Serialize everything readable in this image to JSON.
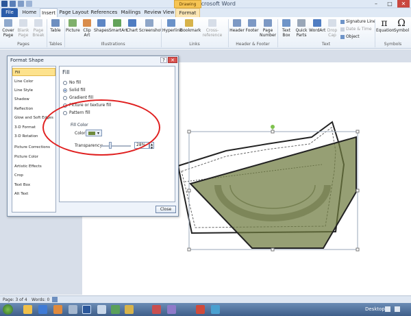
{
  "window": {
    "title": "Doc2 - Microsoft Word",
    "context_tab": "Drawing Tools",
    "controls": {
      "minimize": "–",
      "maximize": "□",
      "close": "✕"
    }
  },
  "quick_access": {
    "save_icon": "save-icon",
    "undo_icon": "undo-icon",
    "redo_icon": "redo-icon"
  },
  "tabs": [
    "File",
    "Home",
    "Insert",
    "Page Layout",
    "References",
    "Mailings",
    "Review",
    "View",
    "Format"
  ],
  "active_tab": "Insert",
  "ribbon": {
    "pages": {
      "cover_page": "Cover Page",
      "blank_page": "Blank Page",
      "page_break": "Page Break",
      "group": "Pages"
    },
    "tables": {
      "table": "Table",
      "group": "Tables"
    },
    "illustrations": {
      "picture": "Picture",
      "clip_art": "Clip Art",
      "shapes": "Shapes",
      "smartart": "SmartArt",
      "chart": "Chart",
      "screenshot": "Screenshot",
      "group": "Illustrations"
    },
    "links": {
      "hyperlink": "Hyperlink",
      "bookmark": "Bookmark",
      "cross_reference": "Cross-reference",
      "group": "Links"
    },
    "header_footer": {
      "header": "Header",
      "footer": "Footer",
      "page_number": "Page Number",
      "group": "Header & Footer"
    },
    "text": {
      "text_box": "Text Box",
      "quick_parts": "Quick Parts",
      "wordart": "WordArt",
      "drop_cap": "Drop Cap",
      "signature_line": "Signature Line",
      "date_time": "Date & Time",
      "object": "Object",
      "group": "Text"
    },
    "symbols": {
      "equation": "Equation",
      "symbol": "Symbol",
      "group": "Symbols",
      "equation_glyph": "π",
      "symbol_glyph": "Ω"
    }
  },
  "dialog": {
    "title": "Format Shape",
    "help": "?",
    "close_x": "✕",
    "categories": [
      "Fill",
      "Line Color",
      "Line Style",
      "Shadow",
      "Reflection",
      "Glow and Soft Edges",
      "3-D Format",
      "3-D Rotation",
      "Picture Corrections",
      "Picture Color",
      "Artistic Effects",
      "Crop",
      "Text Box",
      "Alt Text"
    ],
    "selected_category": "Fill",
    "panel_heading": "Fill",
    "fill_options": [
      "No fill",
      "Solid fill",
      "Gradient fill",
      "Picture or texture fill",
      "Pattern fill"
    ],
    "selected_fill": "Solid fill",
    "fill_color_heading": "Fill Color",
    "color_label": "Color:",
    "transparency_label": "Transparency:",
    "transparency_value": "28%",
    "transparency_level": 0.28,
    "close_button": "Close"
  },
  "status_bar": {
    "page": "Page: 3 of 4",
    "words": "Words: 0"
  },
  "taskbar": {
    "desktop": "Desktop"
  },
  "colors": {
    "accent_file_tab": "#2a5caa",
    "shape_fill": "#6e7a3e",
    "highlight": "#e02020",
    "selection": "#fde28d"
  }
}
